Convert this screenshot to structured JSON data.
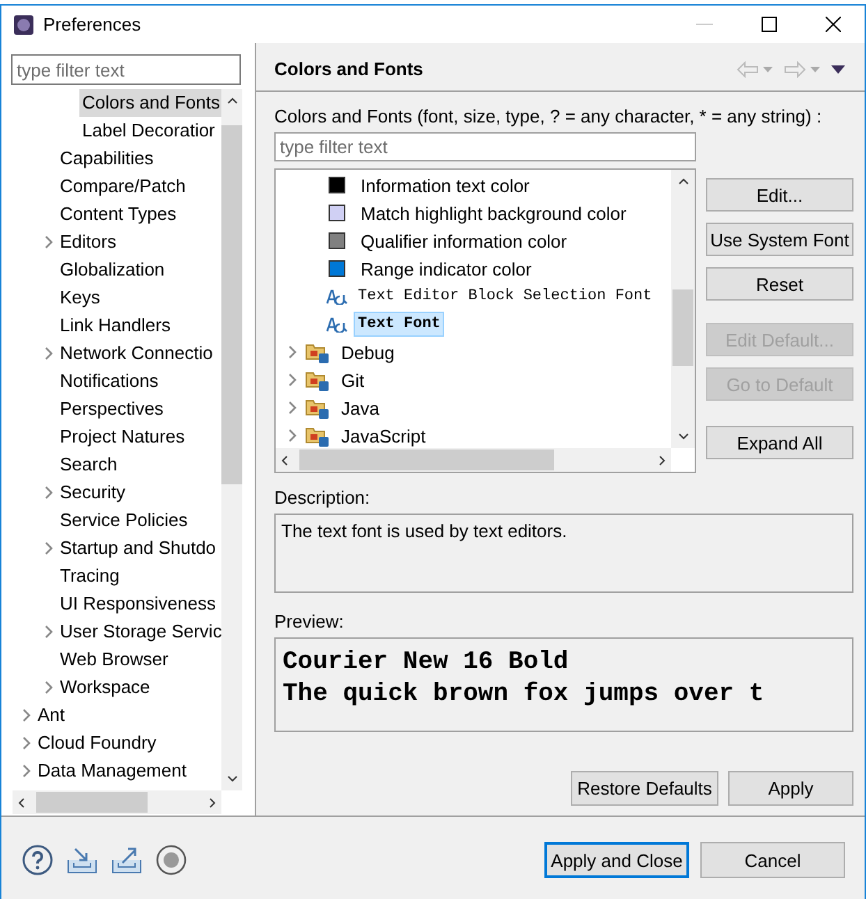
{
  "window": {
    "title": "Preferences"
  },
  "filter": {
    "placeholder": "type filter text"
  },
  "nav_tree": [
    {
      "children": [
        {
          "children": [
            {
              "label": "Colors and Fonts",
              "expandable": false,
              "selected": true
            },
            {
              "label": "Label Decoratior",
              "expandable": false,
              "selected": false
            }
          ]
        },
        {
          "label": "Capabilities",
          "expandable": false,
          "selected": false
        },
        {
          "label": "Compare/Patch",
          "expandable": false,
          "selected": false
        },
        {
          "label": "Content Types",
          "expandable": false,
          "selected": false
        },
        {
          "label": "Editors",
          "expandable": true,
          "selected": false
        },
        {
          "label": "Globalization",
          "expandable": false,
          "selected": false
        },
        {
          "label": "Keys",
          "expandable": false,
          "selected": false
        },
        {
          "label": "Link Handlers",
          "expandable": false,
          "selected": false
        },
        {
          "label": "Network Connectio",
          "expandable": true,
          "selected": false
        },
        {
          "label": "Notifications",
          "expandable": false,
          "selected": false
        },
        {
          "label": "Perspectives",
          "expandable": false,
          "selected": false
        },
        {
          "label": "Project Natures",
          "expandable": false,
          "selected": false
        },
        {
          "label": "Search",
          "expandable": false,
          "selected": false
        },
        {
          "label": "Security",
          "expandable": true,
          "selected": false
        },
        {
          "label": "Service Policies",
          "expandable": false,
          "selected": false
        },
        {
          "label": "Startup and Shutdo",
          "expandable": true,
          "selected": false
        },
        {
          "label": "Tracing",
          "expandable": false,
          "selected": false
        },
        {
          "label": "UI Responsiveness",
          "expandable": false,
          "selected": false
        },
        {
          "label": "User Storage Servic",
          "expandable": true,
          "selected": false
        },
        {
          "label": "Web Browser",
          "expandable": false,
          "selected": false
        },
        {
          "label": "Workspace",
          "expandable": true,
          "selected": false
        }
      ]
    },
    {
      "label": "Ant",
      "expandable": true,
      "selected": false
    },
    {
      "label": "Cloud Foundry",
      "expandable": true,
      "selected": false
    },
    {
      "label": "Data Management",
      "expandable": true,
      "selected": false
    }
  ],
  "page": {
    "title": "Colors and Fonts",
    "intro": "Colors and Fonts (font, size, type, ? = any character, * = any string) :",
    "filter_placeholder": "type filter text"
  },
  "items": [
    {
      "kind": "color",
      "label": "Information text color",
      "color": "#000000",
      "selected": false
    },
    {
      "kind": "color",
      "label": "Match highlight background color",
      "color": "#d0d0f4",
      "selected": false
    },
    {
      "kind": "color",
      "label": "Qualifier information color",
      "color": "#808080",
      "selected": false
    },
    {
      "kind": "color",
      "label": "Range indicator color",
      "color": "#0078d7",
      "selected": false
    },
    {
      "kind": "font",
      "label": "Text Editor Block Selection Font",
      "selected": false
    },
    {
      "kind": "font",
      "label": "Text Font",
      "selected": true
    },
    {
      "kind": "category",
      "label": "Debug",
      "selected": false
    },
    {
      "kind": "category",
      "label": "Git",
      "selected": false
    },
    {
      "kind": "category",
      "label": "Java",
      "selected": false
    },
    {
      "kind": "category",
      "label": "JavaScript",
      "selected": false
    }
  ],
  "side_buttons": [
    {
      "label": "Edit...",
      "disabled": false
    },
    {
      "label": "Use System Font",
      "disabled": false
    },
    {
      "label": "Reset",
      "disabled": false
    },
    {
      "label": "Edit Default...",
      "disabled": true
    },
    {
      "label": "Go to Default",
      "disabled": true
    },
    {
      "label": "Expand All",
      "disabled": false
    }
  ],
  "description": {
    "label": "Description:",
    "text": "The text font is used by text editors."
  },
  "preview": {
    "label": "Preview:",
    "lines": [
      "Courier New 16 Bold",
      "The quick brown fox jumps over t"
    ]
  },
  "page_buttons": [
    "Restore Defaults",
    "Apply"
  ],
  "dialog_buttons": [
    {
      "label": "Apply and Close",
      "default": true
    },
    {
      "label": "Cancel",
      "default": false
    }
  ]
}
